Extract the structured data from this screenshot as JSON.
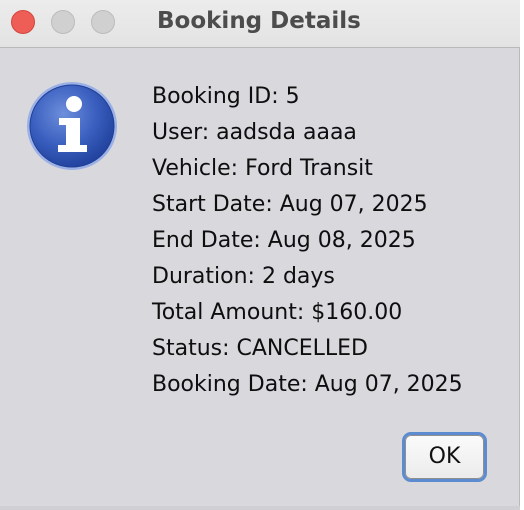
{
  "window": {
    "title": "Booking Details"
  },
  "dialog": {
    "icon": "info-icon",
    "lines": [
      "Booking ID: 5",
      "User: aadsda aaaa",
      "Vehicle: Ford Transit",
      "Start Date: Aug 07, 2025",
      "End Date: Aug 08, 2025",
      "Duration: 2 days",
      "Total Amount: $160.00",
      "Status: CANCELLED",
      "Booking Date: Aug 07, 2025"
    ],
    "ok_label": "OK"
  },
  "colors": {
    "close_button": "#ee5e56",
    "inactive_button": "#d0d0d0",
    "dialog_background": "#d8d8dd",
    "icon_blue": "#2f56b3",
    "focus_ring": "#5c8ccf"
  }
}
